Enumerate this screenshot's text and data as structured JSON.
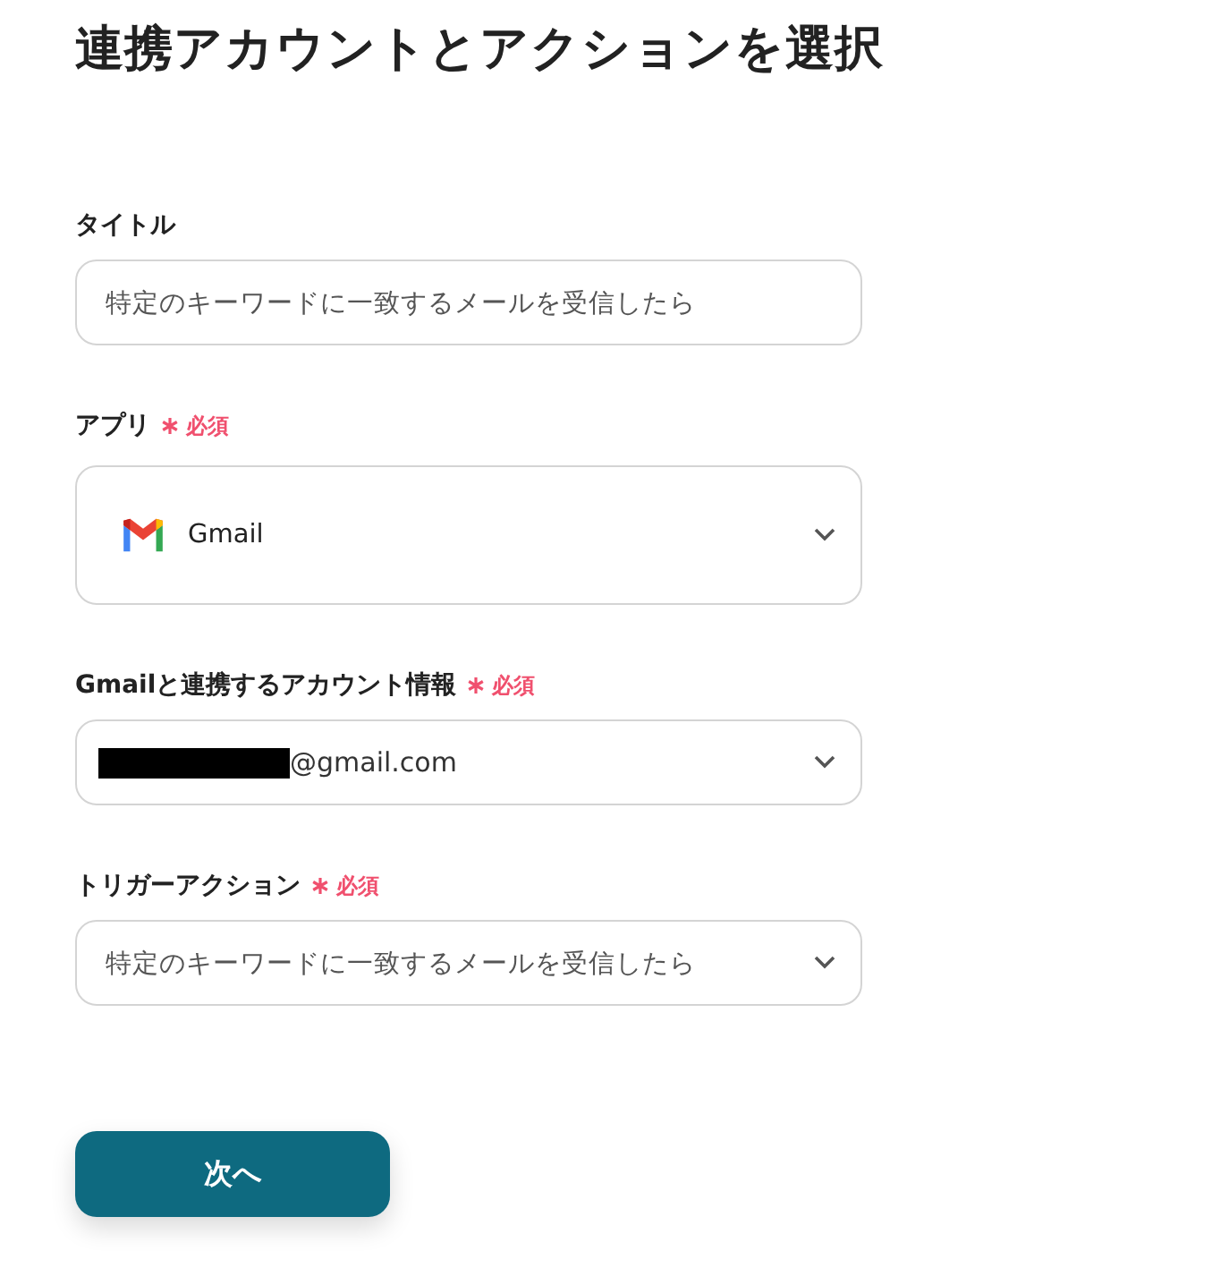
{
  "heading": "連携アカウントとアクションを選択",
  "fields": [
    {
      "kind": "text",
      "label": "タイトル",
      "value": "特定のキーワードに一致するメールを受信したら"
    },
    {
      "kind": "app",
      "label": "アプリ",
      "required": "必須",
      "value": "Gmail"
    },
    {
      "kind": "account",
      "label": "Gmailと連携するアカウント情報",
      "required": "必須",
      "value": "@gmail.com",
      "redacted": true
    },
    {
      "kind": "select",
      "label": "トリガーアクション",
      "required": "必須",
      "value": "特定のキーワードに一致するメールを受信したら"
    }
  ],
  "button": "次へ"
}
